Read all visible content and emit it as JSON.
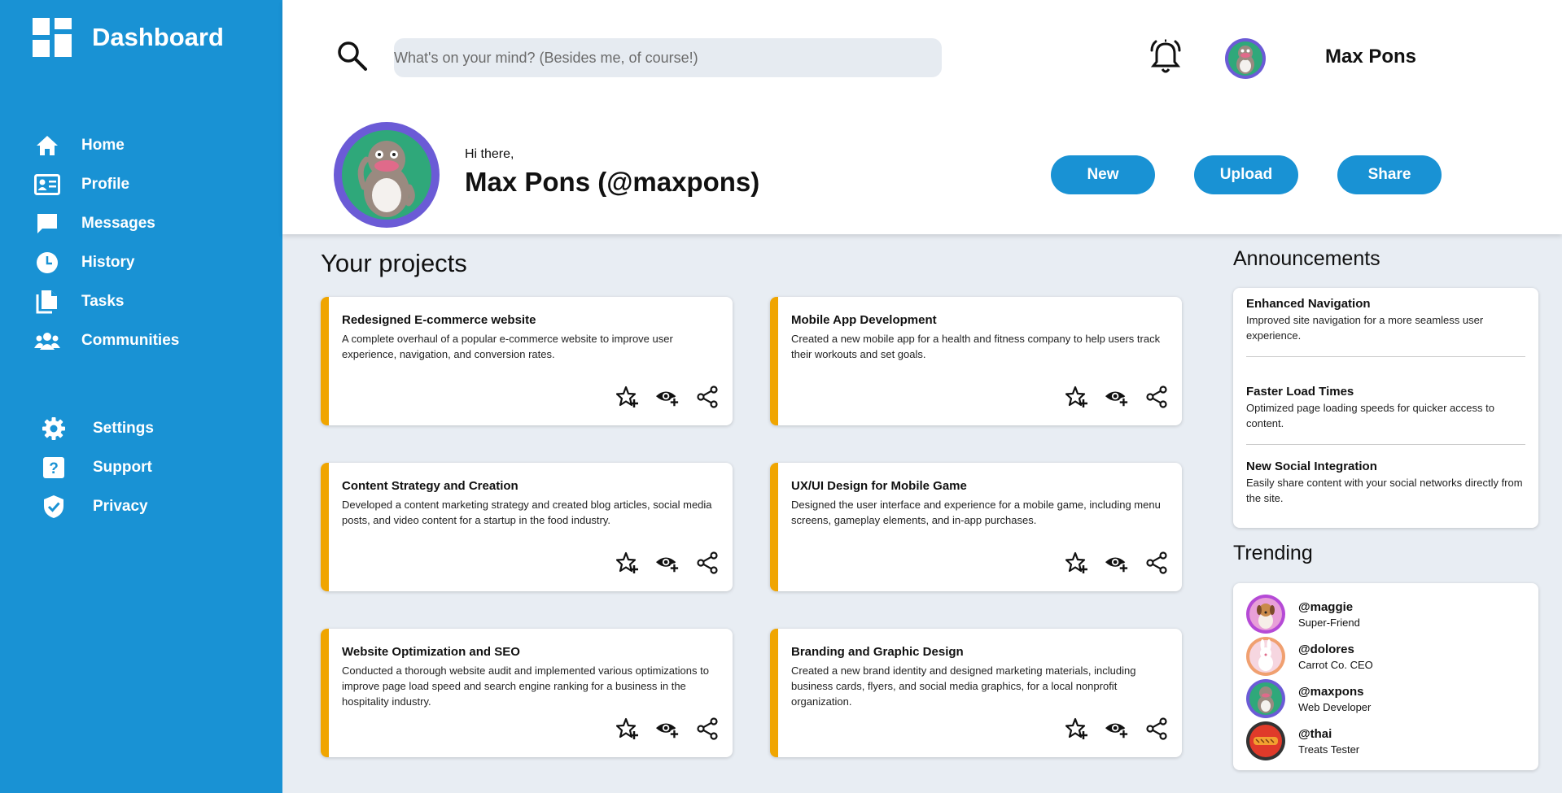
{
  "sidebar": {
    "brand": "Dashboard",
    "items": [
      {
        "label": "Home",
        "icon": "home-icon"
      },
      {
        "label": "Profile",
        "icon": "profile-card-icon"
      },
      {
        "label": "Messages",
        "icon": "message-icon"
      },
      {
        "label": "History",
        "icon": "clock-icon"
      },
      {
        "label": "Tasks",
        "icon": "documents-icon"
      },
      {
        "label": "Communities",
        "icon": "group-icon"
      }
    ],
    "secondary": [
      {
        "label": "Settings",
        "icon": "gear-icon"
      },
      {
        "label": "Support",
        "icon": "help-icon"
      },
      {
        "label": "Privacy",
        "icon": "shield-icon"
      }
    ]
  },
  "header": {
    "search_placeholder": "What's on your mind? (Besides me, of course!)",
    "username": "Max Pons",
    "greeting": "Hi there,",
    "display_name": "Max Pons (@maxpons)",
    "buttons": {
      "new": "New",
      "upload": "Upload",
      "share": "Share"
    }
  },
  "projects": {
    "title": "Your projects",
    "items": [
      {
        "title": "Redesigned E-commerce website",
        "description": "A complete overhaul of a popular e-commerce website to improve user experience, navigation, and conversion rates."
      },
      {
        "title": "Mobile App Development",
        "description": "Created a new mobile app for a health and fitness company to help users track their workouts and set goals."
      },
      {
        "title": "Content Strategy and Creation",
        "description": "Developed a content marketing strategy and created blog articles, social media posts, and video content for a startup in the food industry."
      },
      {
        "title": "UX/UI Design for Mobile Game",
        "description": "Designed the user interface and experience for a mobile game, including menu screens, gameplay elements, and in-app purchases."
      },
      {
        "title": "Website Optimization and SEO",
        "description": "Conducted a thorough website audit and implemented various optimizations to improve page load speed and search engine ranking for a business in the hospitality industry."
      },
      {
        "title": "Branding and Graphic Design",
        "description": "Created a new brand identity and designed marketing materials, including business cards, flyers, and social media graphics, for a local nonprofit organization."
      }
    ]
  },
  "announcements": {
    "title": "Announcements",
    "items": [
      {
        "title": "Enhanced Navigation",
        "description": "Improved site navigation for a more seamless user experience."
      },
      {
        "title": "Faster Load Times",
        "description": "Optimized page loading speeds for quicker access to content."
      },
      {
        "title": "New Social Integration",
        "description": "Easily share content with your social networks directly from the site."
      }
    ]
  },
  "trending": {
    "title": "Trending",
    "items": [
      {
        "handle": "@maggie",
        "role": "Super-Friend"
      },
      {
        "handle": "@dolores",
        "role": "Carrot Co. CEO"
      },
      {
        "handle": "@maxpons",
        "role": "Web Developer"
      },
      {
        "handle": "@thai",
        "role": "Treats Tester"
      }
    ]
  },
  "colors": {
    "sidebar": "#1992d4",
    "accent": "#f0a500",
    "background": "#e8edf3"
  }
}
